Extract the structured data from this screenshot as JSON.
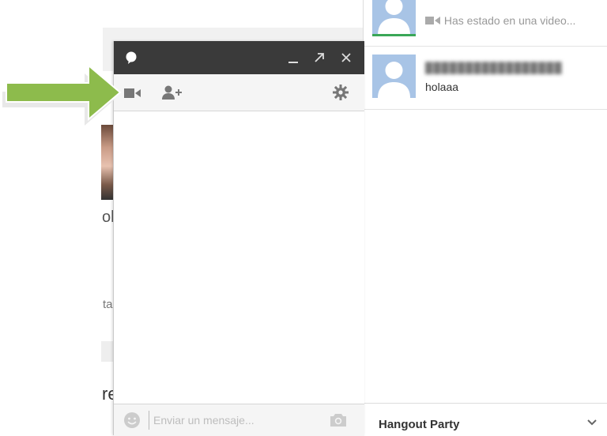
{
  "background_page": {
    "text_fragment_1": "oll",
    "text_fragment_2": "tar",
    "text_fragment_3": "re"
  },
  "chat_window": {
    "titlebar": {
      "chat_icon": "speech-bubble-icon",
      "minimize_icon": "minimize-icon",
      "popout_icon": "popout-arrow-icon",
      "close_icon": "close-icon"
    },
    "toolbar": {
      "video_icon": "video-camera-icon",
      "add_person_icon": "add-person-icon",
      "settings_icon": "gear-icon"
    },
    "input": {
      "placeholder": "Enviar un mensaje...",
      "emoji_icon": "emoji-icon",
      "camera_icon": "camera-icon"
    }
  },
  "annotation": {
    "arrow_color": "#8dbb4c",
    "arrow_icon": "green-arrow-icon"
  },
  "contacts": [
    {
      "name": "████████████",
      "preview": "Has estado en una video..."
    },
    {
      "name": "█████████████████",
      "preview": "holaaa"
    }
  ],
  "footer": {
    "label": "Hangout Party",
    "chevron_icon": "chevron-down-icon"
  },
  "colors": {
    "titlebar": "#3a3a3a",
    "avatar_bg": "#a8c4e6",
    "active_indicator": "#3aa757"
  }
}
